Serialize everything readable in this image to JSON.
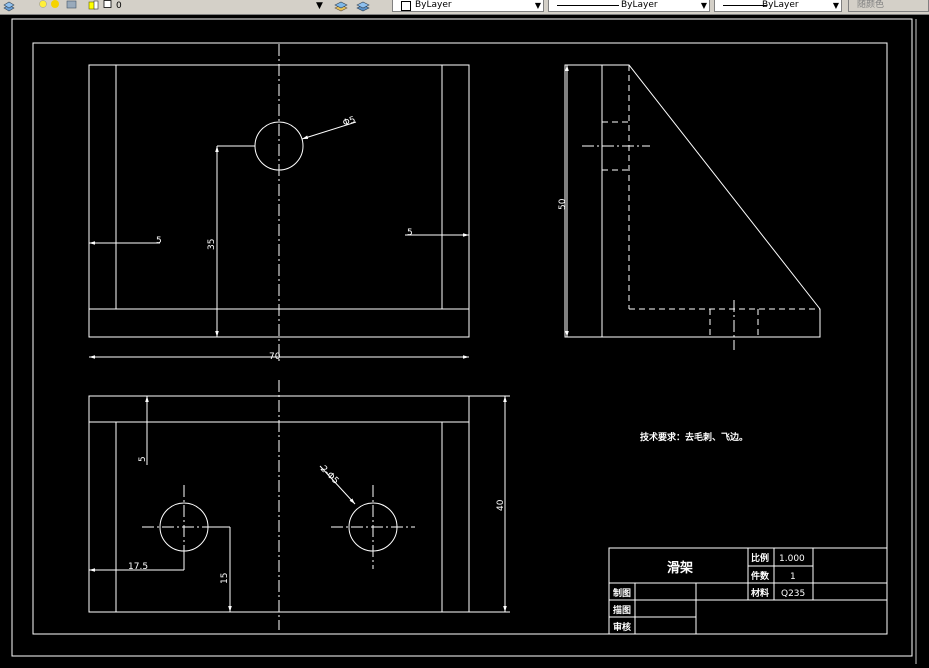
{
  "toolbar": {
    "layer_name": "0",
    "color_value": "ByLayer",
    "linetype_value": "ByLayer",
    "lineweight_value": "ByLayer",
    "plotstyle_value": "随颜色"
  },
  "drawing": {
    "dims": {
      "front_phi": "Φ5",
      "front_height": "35",
      "front_left": "5",
      "front_right": "5",
      "front_width": "70",
      "side_height": "50",
      "top_offset": "5",
      "top_hole": "2-Φ5",
      "top_left": "17.5",
      "top_bottom": "15",
      "top_height": "40"
    },
    "note": "技术要求：去毛刺、飞边。"
  },
  "title_block": {
    "part_name": "滑架",
    "scale_label": "比例",
    "scale_value": "1.000",
    "qty_label": "件数",
    "qty_value": "1",
    "material_label": "材料",
    "material_value": "Q235",
    "drawn_label": "制图",
    "traced_label": "描图",
    "checked_label": "审核"
  },
  "colors": {
    "background": "#000000",
    "line": "#ffffff",
    "toolbar": "#d4d0c8"
  }
}
